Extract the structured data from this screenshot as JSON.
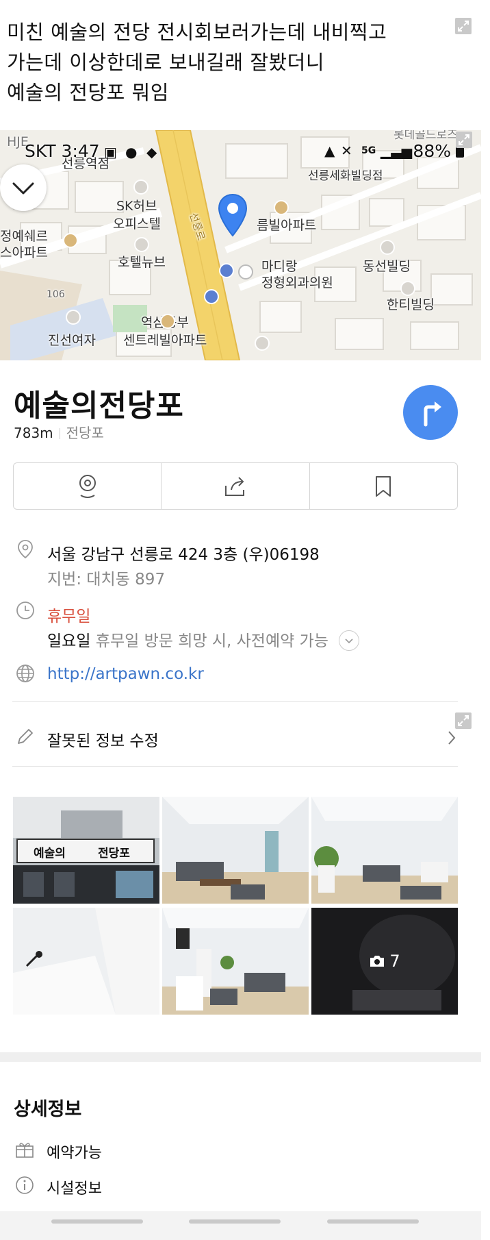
{
  "caption": {
    "lines": [
      "미친 예술의 전당 전시회보러가는데 내비찍고",
      "가는데 이상한데로 보내길래 잘봤더니",
      "예술의 전당포 뭐임"
    ]
  },
  "status_bar": {
    "carrier_time": "SKT 3:47",
    "battery": "88%",
    "network": "5G"
  },
  "map": {
    "labels": {
      "station": "선릉역점",
      "hje": "HJE",
      "sk_hub": "SK허브",
      "officetel": "오피스텔",
      "hotel": "호텔뉴브",
      "building_left1": "정예쉐르",
      "building_left2": "스아파트",
      "seonreung_bldg": "선릉세화빌딩점",
      "lotte": "롯데골드로즈",
      "rumvil": "름빌아파트",
      "madiang1": "마디랑",
      "madiang2": "정형외과의원",
      "dongseon": "동선빌딩",
      "hanti": "한티빌딩",
      "yeoksam1": "역삼동부",
      "yeoksam2": "센트레빌아파트",
      "jinseon": "진선여자",
      "road_name": "선릉로",
      "road_num": "106"
    }
  },
  "place": {
    "name": "예술의전당포",
    "distance": "783m",
    "category": "전당포"
  },
  "info": {
    "address": "서울 강남구 선릉로 424 3층 (우)06198",
    "lot_address": "지번: 대치동 897",
    "closed_label": "휴무일",
    "sunday_label": "일요일",
    "sunday_note": "휴무일 방문 희망 시, 사전예약 가능",
    "website": "http://artpawn.co.kr",
    "edit_info": "잘못된 정보 수정"
  },
  "photos": {
    "sign_left": "예술의",
    "sign_right": "전당포",
    "more_count": "7"
  },
  "details": {
    "title": "상세정보",
    "items": [
      "예약가능",
      "시설정보"
    ]
  },
  "colors": {
    "accent_blue": "#4a8cf0",
    "closed_red": "#d9513f",
    "link_blue": "#3a74c9",
    "road_yellow": "#f3d36a"
  }
}
